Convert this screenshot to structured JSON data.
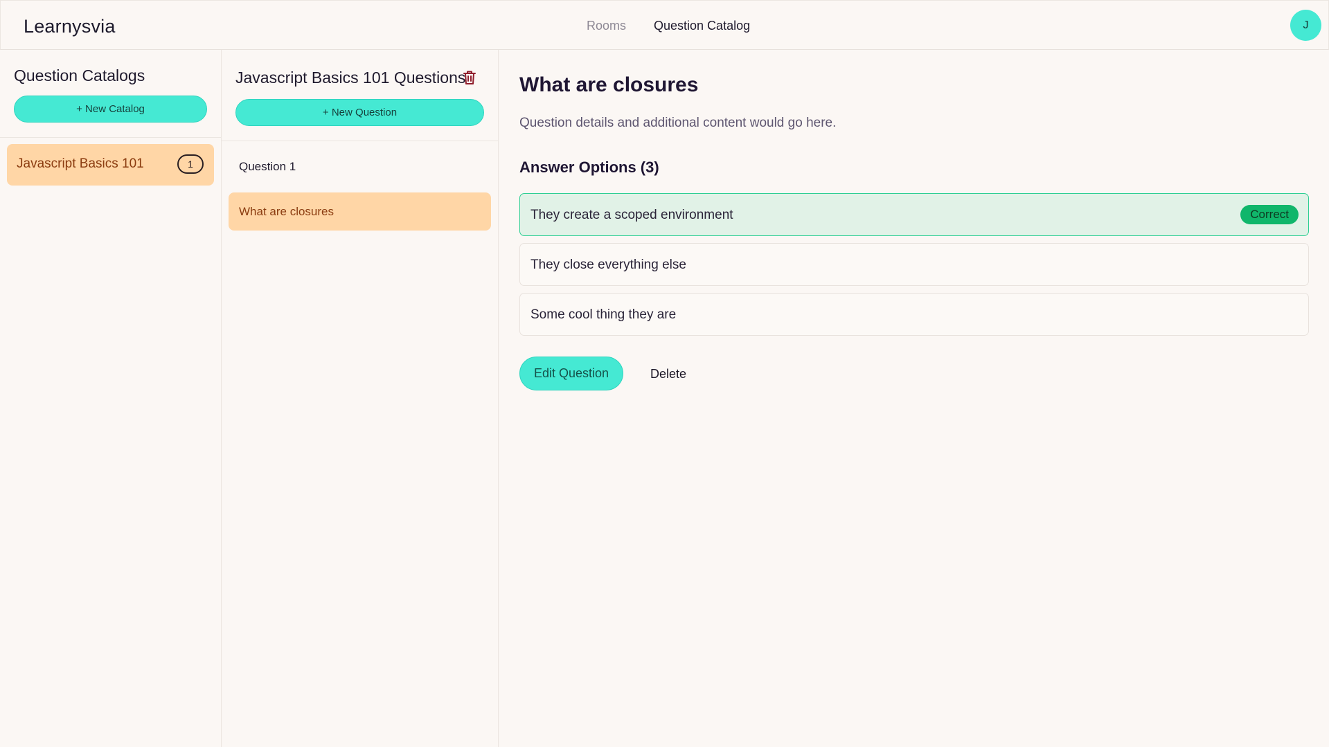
{
  "header": {
    "brand": "Learnysvia",
    "nav": [
      "Rooms",
      "Question Catalog"
    ],
    "avatar_initial": "J"
  },
  "catalogs": {
    "title": "Question Catalogs",
    "new_button": "+ New Catalog",
    "items": [
      {
        "name": "Javascript Basics 101",
        "count": "1"
      }
    ]
  },
  "questions": {
    "title": "Javascript Basics 101 Questions",
    "new_button": "+ New Question",
    "group_label": "Question 1",
    "items": [
      {
        "label": "What are closures"
      }
    ]
  },
  "detail": {
    "title": "What are closures",
    "description": "Question details and additional content would go here.",
    "answers_title": "Answer Options (3)",
    "answers": [
      {
        "text": "They create a scoped environment",
        "badge": "Correct"
      },
      {
        "text": "They close everything else"
      },
      {
        "text": "Some cool thing they are"
      }
    ],
    "edit_button": "Edit Question",
    "delete_button": "Delete"
  },
  "colors": {
    "accent": "#45e9d3",
    "selected": "#ffd6a6",
    "correct": "#10b66b"
  }
}
